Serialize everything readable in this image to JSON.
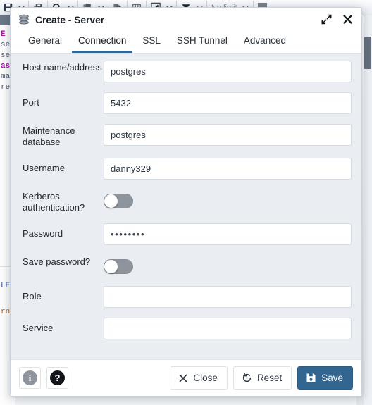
{
  "background": {
    "toolbar": {
      "items": [
        {
          "name": "save-data-icon",
          "type": "icon"
        },
        {
          "name": "chevron-down-icon",
          "type": "caret"
        },
        {
          "name": "stacked-save-icon",
          "type": "icon"
        },
        {
          "name": "search-icon",
          "type": "icon"
        },
        {
          "name": "chevron-down-icon",
          "type": "caret"
        },
        {
          "name": "copy-icon",
          "type": "icon"
        },
        {
          "name": "chevron-down-icon",
          "type": "caret"
        },
        {
          "name": "paste-icon",
          "type": "icon"
        },
        {
          "name": "delete-rows-icon",
          "type": "icon"
        },
        {
          "name": "edit-query-icon",
          "type": "icon"
        },
        {
          "name": "chevron-down-icon",
          "type": "caret"
        },
        {
          "name": "filter-icon",
          "type": "icon"
        },
        {
          "name": "chevron-down-icon",
          "type": "caret"
        }
      ],
      "row_limit_label": "No limit",
      "row_limit_caret": "chevron-down-icon",
      "stop-button": "stop-icon"
    },
    "code_lines": [
      {
        "text": "E",
        "class": "c-kw"
      },
      {
        "text": "se",
        "class": "c-txt"
      },
      {
        "text": "se",
        "class": "c-txt"
      },
      {
        "text": "as",
        "class": "c-kw"
      },
      {
        "text": "ma",
        "class": "c-txt"
      },
      {
        "text": "re",
        "class": "c-txt"
      }
    ],
    "code_lines_lower": [
      {
        "text": "LE",
        "class": "c-blue"
      },
      {
        "text": "rn",
        "class": "c-orange"
      }
    ]
  },
  "dialog": {
    "title": "Create - Server",
    "title_icon": "server-stack-icon",
    "maximize_icon": "expand-diagonal-icon",
    "close_icon": "close-x-icon",
    "tabs": [
      {
        "label": "General",
        "active": false
      },
      {
        "label": "Connection",
        "active": true
      },
      {
        "label": "SSL",
        "active": false
      },
      {
        "label": "SSH Tunnel",
        "active": false
      },
      {
        "label": "Advanced",
        "active": false
      }
    ],
    "fields": [
      {
        "label": "Host name/address",
        "value": "postgres",
        "placeholder": "",
        "type": "text"
      },
      {
        "label": "Port",
        "value": "5432",
        "placeholder": "",
        "type": "text"
      },
      {
        "label": "Maintenance database",
        "value": "postgres",
        "placeholder": "",
        "type": "text"
      },
      {
        "label": "Username",
        "value": "danny329",
        "placeholder": "",
        "type": "text"
      },
      {
        "label": "Kerberos authentication?",
        "value": "off",
        "type": "toggle"
      },
      {
        "label": "Password",
        "value": "••••••••",
        "placeholder": "",
        "type": "password"
      },
      {
        "label": "Save password?",
        "value": "off",
        "type": "toggle"
      },
      {
        "label": "Role",
        "value": "",
        "placeholder": "",
        "type": "text"
      },
      {
        "label": "Service",
        "value": "",
        "placeholder": "",
        "type": "text"
      }
    ],
    "footer": {
      "info_label": "i",
      "info_icon": "info-circle-icon",
      "help_label": "?",
      "help_icon": "help-circle-icon",
      "close_label": "Close",
      "close_icon": "close-x-icon",
      "reset_label": "Reset",
      "reset_icon": "reset-circular-arrow-icon",
      "save_label": "Save",
      "save_icon": "floppy-disk-icon"
    },
    "colors": {
      "accent": "#326690",
      "body_background": "#eaeef3",
      "toggle_off_track": "#8d949c"
    }
  }
}
